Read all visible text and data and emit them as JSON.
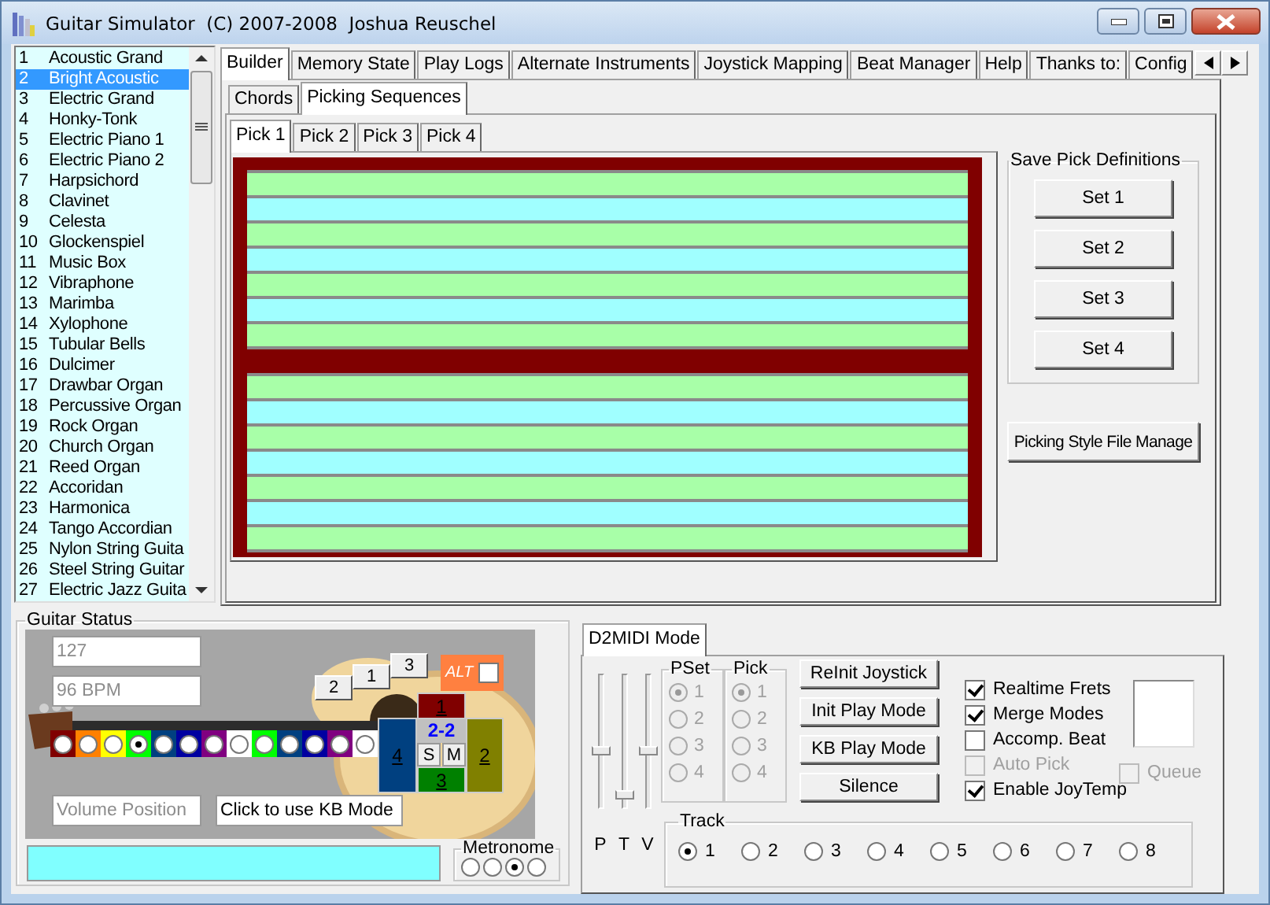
{
  "window": {
    "title": "Guitar Simulator  (C) 2007-2008  Joshua Reuschel"
  },
  "instruments": [
    {
      "number": "1",
      "name": "Acoustic Grand",
      "selected": false
    },
    {
      "number": "2",
      "name": "Bright Acoustic",
      "selected": true
    },
    {
      "number": "3",
      "name": "Electric Grand",
      "selected": false
    },
    {
      "number": "4",
      "name": "Honky-Tonk",
      "selected": false
    },
    {
      "number": "5",
      "name": "Electric Piano 1",
      "selected": false
    },
    {
      "number": "6",
      "name": "Electric Piano 2",
      "selected": false
    },
    {
      "number": "7",
      "name": "Harpsichord",
      "selected": false
    },
    {
      "number": "8",
      "name": "Clavinet",
      "selected": false
    },
    {
      "number": "9",
      "name": "Celesta",
      "selected": false
    },
    {
      "number": "10",
      "name": "Glockenspiel",
      "selected": false
    },
    {
      "number": "11",
      "name": "Music Box",
      "selected": false
    },
    {
      "number": "12",
      "name": "Vibraphone",
      "selected": false
    },
    {
      "number": "13",
      "name": "Marimba",
      "selected": false
    },
    {
      "number": "14",
      "name": "Xylophone",
      "selected": false
    },
    {
      "number": "15",
      "name": "Tubular Bells",
      "selected": false
    },
    {
      "number": "16",
      "name": "Dulcimer",
      "selected": false
    },
    {
      "number": "17",
      "name": "Drawbar Organ",
      "selected": false
    },
    {
      "number": "18",
      "name": "Percussive Organ",
      "selected": false
    },
    {
      "number": "19",
      "name": "Rock Organ",
      "selected": false
    },
    {
      "number": "20",
      "name": "Church Organ",
      "selected": false
    },
    {
      "number": "21",
      "name": "Reed Organ",
      "selected": false
    },
    {
      "number": "22",
      "name": "Accoridan",
      "selected": false
    },
    {
      "number": "23",
      "name": "Harmonica",
      "selected": false
    },
    {
      "number": "24",
      "name": "Tango Accordian",
      "selected": false
    },
    {
      "number": "25",
      "name": "Nylon String Guita",
      "selected": false
    },
    {
      "number": "26",
      "name": "Steel String Guitar",
      "selected": false
    },
    {
      "number": "27",
      "name": "Electric Jazz Guita",
      "selected": false
    }
  ],
  "tabs": [
    {
      "label": "Builder",
      "selected": true
    },
    {
      "label": "Memory State",
      "selected": false
    },
    {
      "label": "Play Logs",
      "selected": false
    },
    {
      "label": "Alternate Instruments",
      "selected": false
    },
    {
      "label": "Joystick Mapping",
      "selected": false
    },
    {
      "label": "Beat Manager",
      "selected": false
    },
    {
      "label": "Help",
      "selected": false
    },
    {
      "label": "Thanks to:",
      "selected": false
    },
    {
      "label": "Config",
      "selected": false
    }
  ],
  "sub_tabs": [
    {
      "label": "Chords",
      "selected": false
    },
    {
      "label": "Picking Sequences",
      "selected": true
    }
  ],
  "pick_tabs": [
    {
      "label": "Pick 1",
      "selected": true
    },
    {
      "label": "Pick 2",
      "selected": false
    },
    {
      "label": "Pick 3",
      "selected": false
    },
    {
      "label": "Pick 4",
      "selected": false
    }
  ],
  "pick_lanes": [
    {
      "lanes": [
        {
          "color": "#a8ffa8"
        },
        {
          "color": "#a0ffff"
        },
        {
          "color": "#a8ffa8"
        },
        {
          "color": "#a0ffff"
        },
        {
          "color": "#a8ffa8"
        },
        {
          "color": "#a0ffff"
        },
        {
          "color": "#a8ffa8"
        }
      ]
    },
    {
      "lanes": [
        {
          "color": "#a8ffa8"
        },
        {
          "color": "#a0ffff"
        },
        {
          "color": "#a8ffa8"
        },
        {
          "color": "#a0ffff"
        },
        {
          "color": "#a8ffa8"
        },
        {
          "color": "#a0ffff"
        },
        {
          "color": "#a8ffa8"
        }
      ]
    }
  ],
  "save_pick_definitions": {
    "title": "Save Pick Definitions",
    "buttons": [
      "Set 1",
      "Set 2",
      "Set 3",
      "Set 4"
    ]
  },
  "file_manager_button": "Picking Style File Manage",
  "guitar_status": {
    "title": "Guitar Status",
    "fields": [
      {
        "kind": "velocity",
        "value": "127",
        "disabled": true
      },
      {
        "kind": "tempo",
        "value": "96 BPM",
        "disabled": true
      },
      {
        "kind": "volume",
        "value": "Volume Position",
        "disabled": true
      },
      {
        "kind": "mode",
        "value": "Click to use KB Mode",
        "disabled": false
      }
    ],
    "chord_buttons": [
      "2",
      "1",
      "3"
    ],
    "alt": {
      "label": "ALT",
      "checked": false
    },
    "frets": [
      {
        "color": "#800000",
        "selected": false
      },
      {
        "color": "#ff8000",
        "selected": false
      },
      {
        "color": "#ffff00",
        "selected": false
      },
      {
        "color": "#00ff00",
        "selected": true
      },
      {
        "color": "#004080",
        "selected": false
      },
      {
        "color": "#0000a0",
        "selected": false
      },
      {
        "color": "#800080",
        "selected": false
      },
      {
        "color": "#ffffff",
        "selected": false
      },
      {
        "color": "#00ff00",
        "selected": false
      },
      {
        "color": "#004080",
        "selected": false
      },
      {
        "color": "#0000a0",
        "selected": false
      },
      {
        "color": "#800080",
        "selected": false
      },
      {
        "color": "#ffffff",
        "selected": false
      }
    ],
    "pad": {
      "readout": "2-2",
      "keys": [
        {
          "kind": "up",
          "label": "1",
          "color": "#800000"
        },
        {
          "kind": "right",
          "label": "2",
          "color": "#808000"
        },
        {
          "kind": "down",
          "label": "3",
          "color": "#008000"
        },
        {
          "kind": "left",
          "label": "4",
          "color": "#004080"
        }
      ],
      "buttons": [
        "S",
        "M"
      ]
    },
    "metronome": {
      "title": "Metronome",
      "options": [
        {
          "selected": false
        },
        {
          "selected": false
        },
        {
          "selected": true
        },
        {
          "selected": false
        }
      ]
    }
  },
  "d2midi": {
    "tab": "D2MIDI Mode",
    "sliders": [
      {
        "label": "P",
        "level": 0.42
      },
      {
        "label": "T",
        "level": 0.07
      },
      {
        "label": "V",
        "level": 0.43
      }
    ],
    "groups": [
      {
        "title": "PSet",
        "disabled": true,
        "options": [
          {
            "label": "1",
            "selected": true
          },
          {
            "label": "2",
            "selected": false
          },
          {
            "label": "3",
            "selected": false
          },
          {
            "label": "4",
            "selected": false
          }
        ]
      },
      {
        "title": "Pick",
        "disabled": true,
        "options": [
          {
            "label": "1",
            "selected": true
          },
          {
            "label": "2",
            "selected": false
          },
          {
            "label": "3",
            "selected": false
          },
          {
            "label": "4",
            "selected": false
          }
        ]
      }
    ],
    "buttons": [
      "ReInit Joystick",
      "Init Play Mode",
      "KB Play Mode",
      "Silence"
    ],
    "checkboxes": [
      {
        "label": "Realtime Frets",
        "checked": true,
        "disabled": false
      },
      {
        "label": "Merge Modes",
        "checked": true,
        "disabled": false
      },
      {
        "label": "Accomp. Beat",
        "checked": false,
        "disabled": false
      },
      {
        "label": "Auto Pick",
        "checked": false,
        "disabled": true
      },
      {
        "label": "Enable JoyTemp",
        "checked": true,
        "disabled": false
      }
    ],
    "queue": {
      "label": "Queue",
      "checked": false,
      "disabled": true
    },
    "track": {
      "title": "Track",
      "options": [
        {
          "label": "1",
          "selected": true
        },
        {
          "label": "2",
          "selected": false
        },
        {
          "label": "3",
          "selected": false
        },
        {
          "label": "4",
          "selected": false
        },
        {
          "label": "5",
          "selected": false
        },
        {
          "label": "6",
          "selected": false
        },
        {
          "label": "7",
          "selected": false
        },
        {
          "label": "8",
          "selected": false
        }
      ]
    }
  }
}
